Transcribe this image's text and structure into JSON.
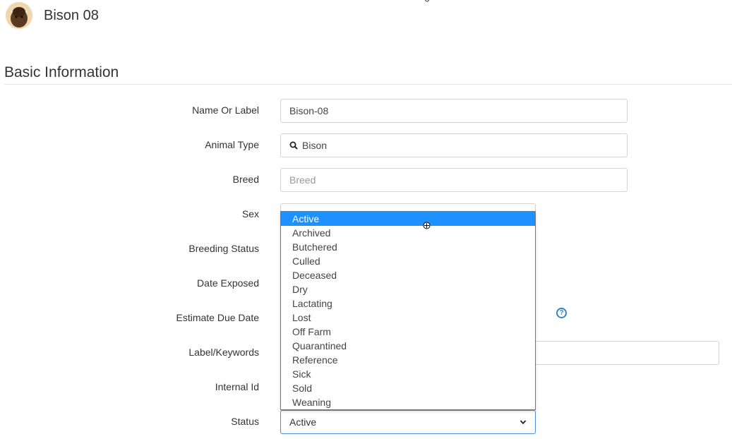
{
  "header": {
    "animal_name": "Bison 08"
  },
  "section": {
    "title": "Basic Information"
  },
  "fields": {
    "name_label": "Name Or Label",
    "name_value": "Bison-08",
    "animal_type_label": "Animal Type",
    "animal_type_value": "Bison",
    "breed_label": "Breed",
    "breed_placeholder": "Breed",
    "sex_label": "Sex",
    "breeding_status_label": "Breeding Status",
    "date_exposed_label": "Date Exposed",
    "estimate_due_date_label": "Estimate Due Date",
    "label_keywords_label": "Label/Keywords",
    "internal_id_label": "Internal Id",
    "status_label": "Status",
    "status_value": "Active"
  },
  "status_options": [
    "Active",
    "Archived",
    "Butchered",
    "Culled",
    "Deceased",
    "Dry",
    "Lactating",
    "Lost",
    "Off Farm",
    "Quarantined",
    "Reference",
    "Sick",
    "Sold",
    "Weaning"
  ],
  "status_selected_index": 0,
  "colors": {
    "accent": "#1e90ff",
    "help_icon": "#2e86c8"
  },
  "icons": {
    "search": "search-icon",
    "help": "help-circle-icon",
    "chevron": "chevron-down-icon"
  }
}
